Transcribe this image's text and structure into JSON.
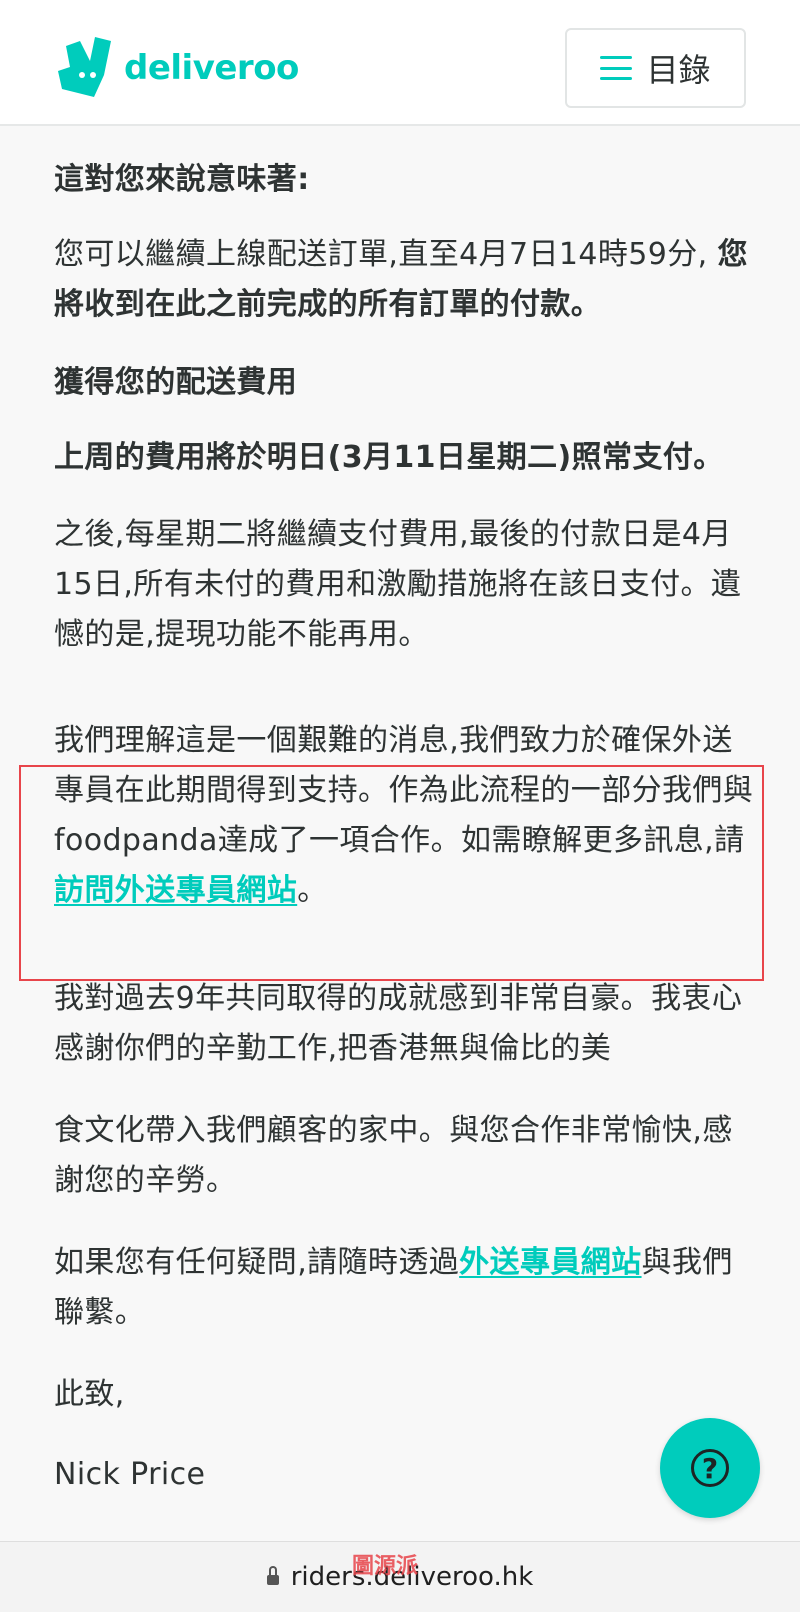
{
  "header": {
    "logo_text": "deliveroo",
    "logo_icon": "deliveroo-kangaroo-icon",
    "menu_icon": "hamburger-icon",
    "menu_label": "目錄"
  },
  "content": {
    "p1": "這對您來說意味著:",
    "p2_normal": "您可以繼續上線配送訂單,直至4月7日14時59分, ",
    "p2_bold": "您將收到在此之前完成的所有訂單的付款。",
    "p3": "獲得您的配送費用",
    "p4": "上周的費用將於明日(3月11日星期二)照常支付。",
    "p5": "之後,每星期二將繼續支付費用,最後的付款日是4月15日,所有未付的費用和激勵措施將在該日支付。遺憾的是,提現功能不能再用。",
    "p6_text": "我們理解這是一個艱難的消息,我們致力於確保外送專員在此期間得到支持。作為此流程的一部分我們與foodpanda達成了一項合作。如需瞭解更多訊息,請",
    "p6_link": "訪問外送專員網站",
    "p6_end": "。",
    "p7": "我對過去9年共同取得的成就感到非常自豪。我衷心感謝你們的辛勤工作,把香港無與倫比的美",
    "p8": "食文化帶入我們顧客的家中。與您合作非常愉快,感謝您的辛勞。",
    "p9_text": "如果您有任何疑問,請隨時透過",
    "p9_link": "外送專員網站",
    "p9_end": "與我們聯繫。",
    "p10": "此致,",
    "p11": "Nick Price"
  },
  "help_button": {
    "icon": "question-mark-icon",
    "symbol": "?"
  },
  "url_bar": {
    "lock_icon": "lock-icon",
    "url": "riders.deliveroo.hk"
  },
  "watermark": "圖源派",
  "colors": {
    "brand_teal": "#00ccbc",
    "highlight_border": "#e8454b",
    "text": "#2e3333",
    "background": "#f8f8f8"
  }
}
